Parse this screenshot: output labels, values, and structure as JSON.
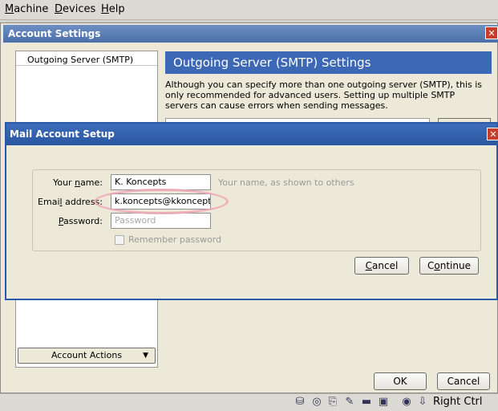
{
  "menubar": {
    "items": [
      {
        "label": "Machine",
        "ul": "M",
        "rest": "achine"
      },
      {
        "label": "Devices",
        "ul": "D",
        "rest": "evices"
      },
      {
        "label": "Help",
        "ul": "H",
        "rest": "elp"
      }
    ]
  },
  "account_settings": {
    "title": "Account Settings",
    "list_item": "Outgoing Server (SMTP)",
    "account_actions": "Account Actions",
    "smtp_header": "Outgoing Server (SMTP) Settings",
    "smtp_description": "Although you can specify more than one outgoing server (SMTP), this is only recommended for advanced users. Setting up multiple SMTP servers can cause errors when sending messages.",
    "ok": "OK",
    "cancel": "Cancel"
  },
  "mail_setup": {
    "title": "Mail Account Setup",
    "name_label_pre": "Your ",
    "name_label_ul": "n",
    "name_label_post": "ame:",
    "name_value": "K. Koncepts",
    "name_hint": "Your name, as shown to others",
    "email_label_pre": "Emai",
    "email_label_ul": "l",
    "email_label_post": " address:",
    "email_value": "k.koncepts@kkoncepts.r",
    "password_label_ul": "P",
    "password_label_post": "assword:",
    "password_placeholder": "Password",
    "remember_password": "Remember password",
    "remember_ul": "m",
    "cancel": "Cancel",
    "cancel_ul": "C",
    "continue": "Continue",
    "continue_ul": "o"
  },
  "statusbar": {
    "host_key": "Right Ctrl",
    "icons": [
      "disk-icon",
      "cd-icon",
      "usb-icon",
      "edit-icon",
      "folder-icon",
      "display-icon",
      "network-icon",
      "arrow-down-icon"
    ]
  }
}
